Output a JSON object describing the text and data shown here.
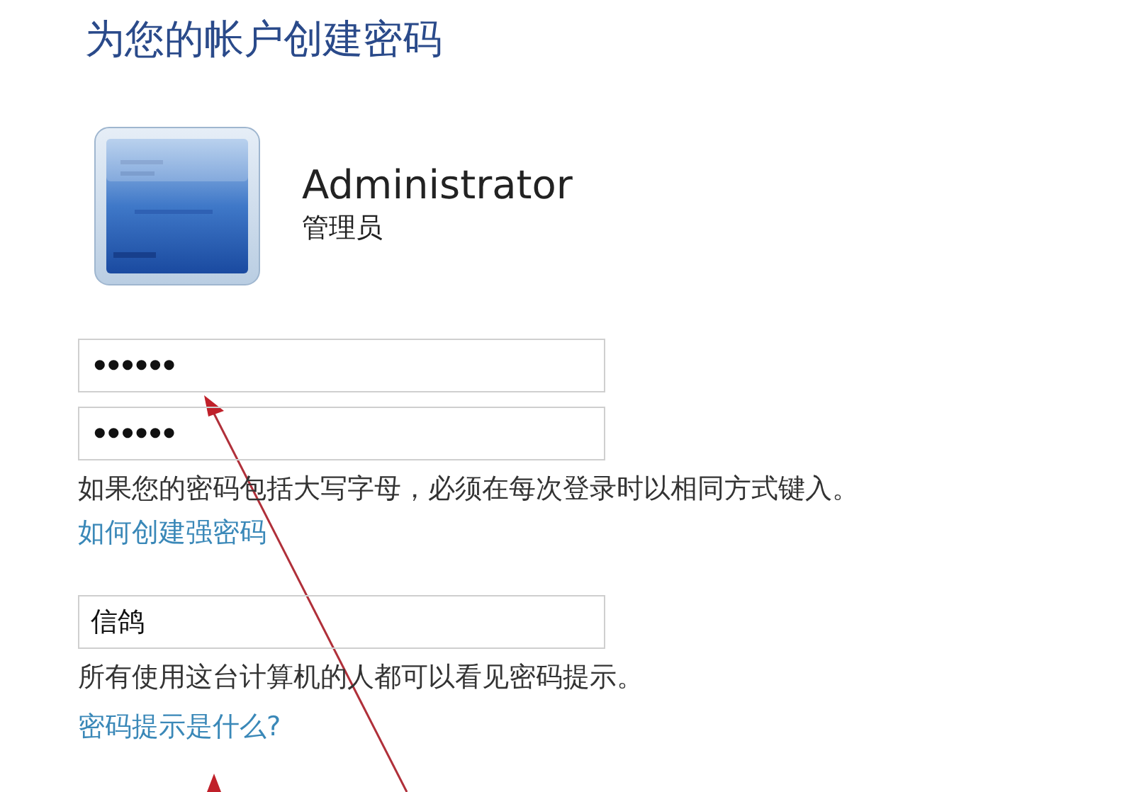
{
  "title": "为您的帐户创建密码",
  "account": {
    "name": "Administrator",
    "role": "管理员"
  },
  "password_fields": [
    {
      "value": "••••••"
    },
    {
      "value": "••••••"
    }
  ],
  "caps_note": "如果您的密码包括大写字母，必须在每次登录时以相同方式键入。",
  "strong_password_link": "如何创建强密码",
  "hint_field": {
    "value": "信鸽"
  },
  "hint_note": "所有使用这台计算机的人都可以看见密码提示。",
  "hint_link": "密码提示是什么?"
}
